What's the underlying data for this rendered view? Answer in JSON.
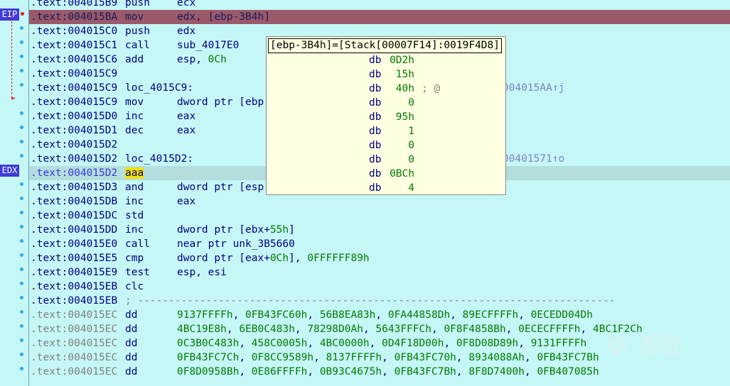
{
  "gutter": {
    "eip_label": "EIP",
    "edx_label": "EDX"
  },
  "rows": [
    {
      "addr": ".text:004015B9",
      "mn": "push",
      "op": "ecx"
    },
    {
      "addr": ".text:004015BA",
      "mn": "mov",
      "op": "edx, [ebp-3B4h]",
      "eip": true
    },
    {
      "addr": ".text:004015C0",
      "mn": "push",
      "op": "edx"
    },
    {
      "addr": ".text:004015C1",
      "mn": "call",
      "op": "sub_4017E0"
    },
    {
      "addr": ".text:004015C6",
      "mn": "add",
      "op": "esp, ",
      "opnum": "0Ch"
    },
    {
      "addr": ".text:004015C9",
      "mn": "",
      "op": ""
    },
    {
      "addr": ".text:004015C9",
      "mn": "loc_4015C9:",
      "op": "",
      "ref": "004015AA↑j"
    },
    {
      "addr": ".text:004015C9",
      "mn": "mov",
      "op": "dword ptr [ebp"
    },
    {
      "addr": ".text:004015D0",
      "mn": "inc",
      "op": "eax"
    },
    {
      "addr": ".text:004015D1",
      "mn": "dec",
      "op": "eax"
    },
    {
      "addr": ".text:004015D2",
      "mn": "",
      "op": ""
    },
    {
      "addr": ".text:004015D2",
      "mn": "loc_4015D2:",
      "op": "",
      "ref": "00401571↑o"
    },
    {
      "addr": ".text:004015D2",
      "mn": "aaa",
      "op": "",
      "cur": true
    },
    {
      "addr": ".text:004015D3",
      "mn": "and",
      "op": "dword ptr [esp"
    },
    {
      "addr": ".text:004015DB",
      "mn": "inc",
      "op": "eax"
    },
    {
      "addr": ".text:004015DC",
      "mn": "std",
      "op": ""
    },
    {
      "addr": ".text:004015DD",
      "mn": "inc",
      "op": "dword ptr [ebx+",
      "opnum": "55h",
      "optail": "]"
    },
    {
      "addr": ".text:004015E0",
      "mn": "call",
      "op": "near ptr unk_3B5660"
    },
    {
      "addr": ".text:004015E5",
      "mn": "cmp",
      "op": "dword ptr [eax+",
      "opnum": "0Ch",
      "optail": "], ",
      "opnum2": "0FFFFFF89h"
    },
    {
      "addr": ".text:004015E9",
      "mn": "test",
      "op": "esp, esi"
    },
    {
      "addr": ".text:004015EB",
      "mn": "clc",
      "op": ""
    },
    {
      "addr": ".text:004015EB",
      "mn": "; -----------------------------------------------------------------------------",
      "op": "",
      "sep": true
    },
    {
      "addr": ".text:004015EC",
      "mn": "dd",
      "op": "",
      "data": "9137FFFFh, 0FB43FC60h, 56B8EA83h, 0FA44858Dh, 89ECFFFFh, 0ECEDD04Dh",
      "grayaddr": true
    },
    {
      "addr": ".text:004015EC",
      "mn": "dd",
      "op": "",
      "data": "4BC19E8h, 6EB0C483h, 78298D0Ah, 5643FFFCh, 0F8F4858Bh, 0ECECFFFFh, 4BC1F2Ch",
      "grayaddr": true
    },
    {
      "addr": ".text:004015EC",
      "mn": "dd",
      "op": "",
      "data": "0C3B0C483h, 458C0005h, 4BC0000h, 0D4F18D00h, 0F8D08D89h, 9131FFFFh",
      "grayaddr": true
    },
    {
      "addr": ".text:004015EC",
      "mn": "dd",
      "op": "",
      "data": "0FB43FC7Ch, 0F8CC9589h, 8137FFFFh, 0FB43FC70h, 8934088Ah, 0FB43FC7Bh",
      "grayaddr": true
    },
    {
      "addr": ".text:004015EC",
      "mn": "dd",
      "op": "",
      "data": "0F8D0958Bh, 0E86FFFFh, 0B93C4675h, 0FB43FC7Bh, 8F8D7400h, 0FB407085h",
      "grayaddr": true
    }
  ],
  "popup": {
    "header": "[ebp-3B4h]=[Stack[00007F14]:0019F4D8]",
    "db_label": "db",
    "values": [
      {
        "v": "0D2h",
        "c": ""
      },
      {
        "v": "15h",
        "c": ""
      },
      {
        "v": "40h",
        "c": "; @"
      },
      {
        "v": "0",
        "c": ""
      },
      {
        "v": "95h",
        "c": ""
      },
      {
        "v": "1",
        "c": ""
      },
      {
        "v": "0",
        "c": ""
      },
      {
        "v": "0",
        "c": ""
      },
      {
        "v": "0BCh",
        "c": ""
      },
      {
        "v": "4",
        "c": ""
      }
    ]
  },
  "watermark": {
    "text": "看雪",
    "flake": "❄"
  }
}
